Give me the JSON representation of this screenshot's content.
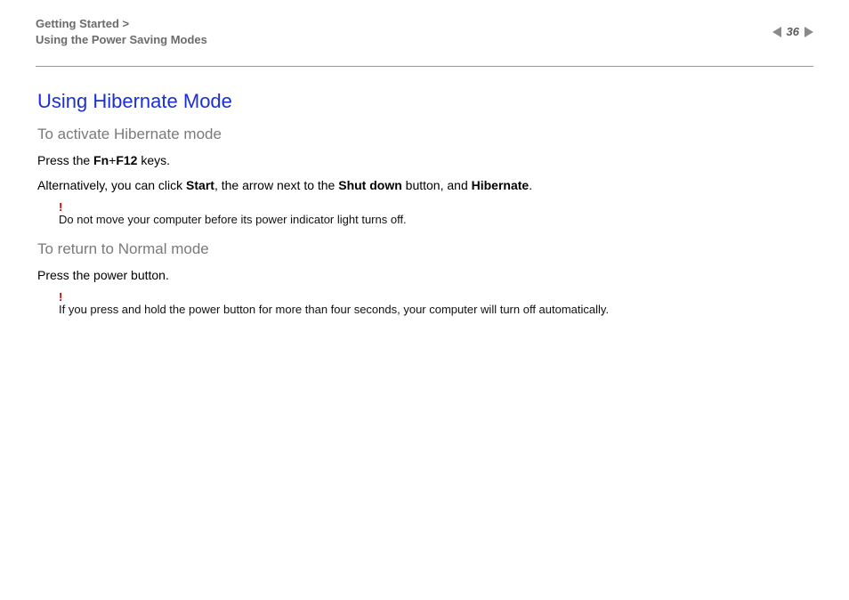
{
  "header": {
    "breadcrumb_root": "Getting Started >",
    "breadcrumb_current": "Using the Power Saving Modes",
    "page_number": "36"
  },
  "content": {
    "title": "Using Hibernate Mode",
    "section1_heading": "To activate Hibernate mode",
    "line1_pre": "Press the ",
    "line1_key1": "Fn",
    "line1_plus": "+",
    "line1_key2": "F12",
    "line1_post": " keys.",
    "line2_pre": "Alternatively, you can click ",
    "line2_b1": "Start",
    "line2_mid1": ", the arrow next to the ",
    "line2_b2": "Shut down",
    "line2_mid2": " button, and ",
    "line2_b3": "Hibernate",
    "line2_post": ".",
    "note1_mark": "!",
    "note1_text": "Do not move your computer before its power indicator light turns off.",
    "section2_heading": "To return to Normal mode",
    "line3": "Press the power button.",
    "note2_mark": "!",
    "note2_text": "If you press and hold the power button for more than four seconds, your computer will turn off automatically."
  }
}
